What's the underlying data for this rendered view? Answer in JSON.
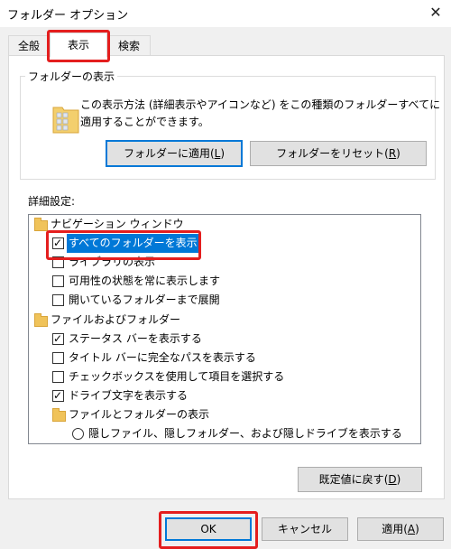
{
  "window": {
    "title": "フォルダー オプション",
    "close_glyph": "✕"
  },
  "tabs": [
    {
      "label": "全般"
    },
    {
      "label": "表示"
    },
    {
      "label": "検索"
    }
  ],
  "folder_view": {
    "legend": "フォルダーの表示",
    "desc_line1": "この表示方法 (詳細表示やアイコンなど) をこの種類のフォルダーすべてに",
    "desc_line2": "適用することができます。",
    "apply_label": "フォルダーに適用",
    "apply_key": "L",
    "reset_label": "フォルダーをリセット",
    "reset_key": "R"
  },
  "advanced": {
    "label": "詳細設定:",
    "items": [
      {
        "text": "ナビゲーション ウィンドウ",
        "kind": "folder"
      },
      {
        "text": "すべてのフォルダーを表示",
        "kind": "checkbox",
        "checked": true
      },
      {
        "text": "ライブラリの表示",
        "kind": "checkbox",
        "checked": false
      },
      {
        "text": "可用性の状態を常に表示します",
        "kind": "checkbox",
        "checked": false
      },
      {
        "text": "開いているフォルダーまで展開",
        "kind": "checkbox",
        "checked": false
      },
      {
        "text": "ファイルおよびフォルダー",
        "kind": "folder"
      },
      {
        "text": "ステータス バーを表示する",
        "kind": "checkbox",
        "checked": true
      },
      {
        "text": "タイトル バーに完全なパスを表示する",
        "kind": "checkbox",
        "checked": false
      },
      {
        "text": "チェックボックスを使用して項目を選択する",
        "kind": "checkbox",
        "checked": false
      },
      {
        "text": "ドライブ文字を表示する",
        "kind": "checkbox",
        "checked": true
      },
      {
        "text": "ファイルとフォルダーの表示",
        "kind": "folder"
      },
      {
        "text": "隠しファイル、隠しフォルダー、および隠しドライブを表示する",
        "kind": "radio",
        "checked": false
      }
    ],
    "restore_label": "既定値に戻す",
    "restore_key": "D"
  },
  "footer": {
    "ok_label": "OK",
    "cancel_label": "キャンセル",
    "apply_label": "適用",
    "apply_key": "A"
  },
  "colors": {
    "highlight": "#e41e1e",
    "selection": "#0078d7",
    "focus_border": "#0078d7"
  }
}
